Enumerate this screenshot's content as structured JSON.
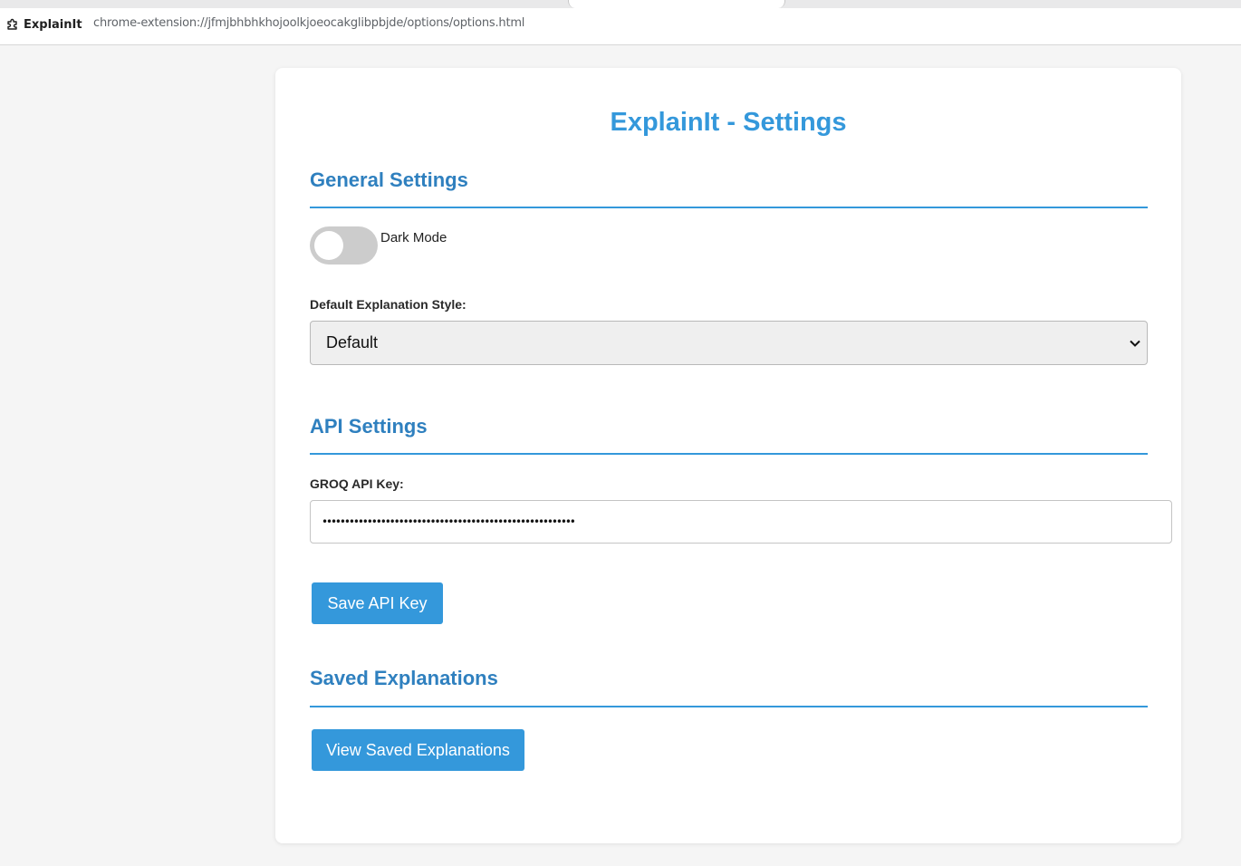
{
  "browser": {
    "extension_name": "ExplainIt",
    "url": "chrome-extension://jfmjbhbhkhojoolkjoeocakglibpbjde/options/options.html"
  },
  "page": {
    "title": "ExplainIt - Settings"
  },
  "general": {
    "heading": "General Settings",
    "dark_mode_label": "Dark Mode",
    "dark_mode_enabled": false,
    "style_label": "Default Explanation Style:",
    "style_value": "Default"
  },
  "api": {
    "heading": "API Settings",
    "key_label": "GROQ API Key:",
    "key_masked": "••••••••••••••••••••••••••••••••••••••••••••••••••••••••",
    "save_label": "Save API Key"
  },
  "saved": {
    "heading": "Saved Explanations",
    "view_label": "View Saved Explanations"
  },
  "colors": {
    "accent": "#3498db",
    "heading": "#2f80bf",
    "toggle_off": "#cccccc",
    "background": "#f5f5f5"
  },
  "icons": {
    "extension": "puzzle-icon",
    "select": "chevron-down-icon"
  }
}
